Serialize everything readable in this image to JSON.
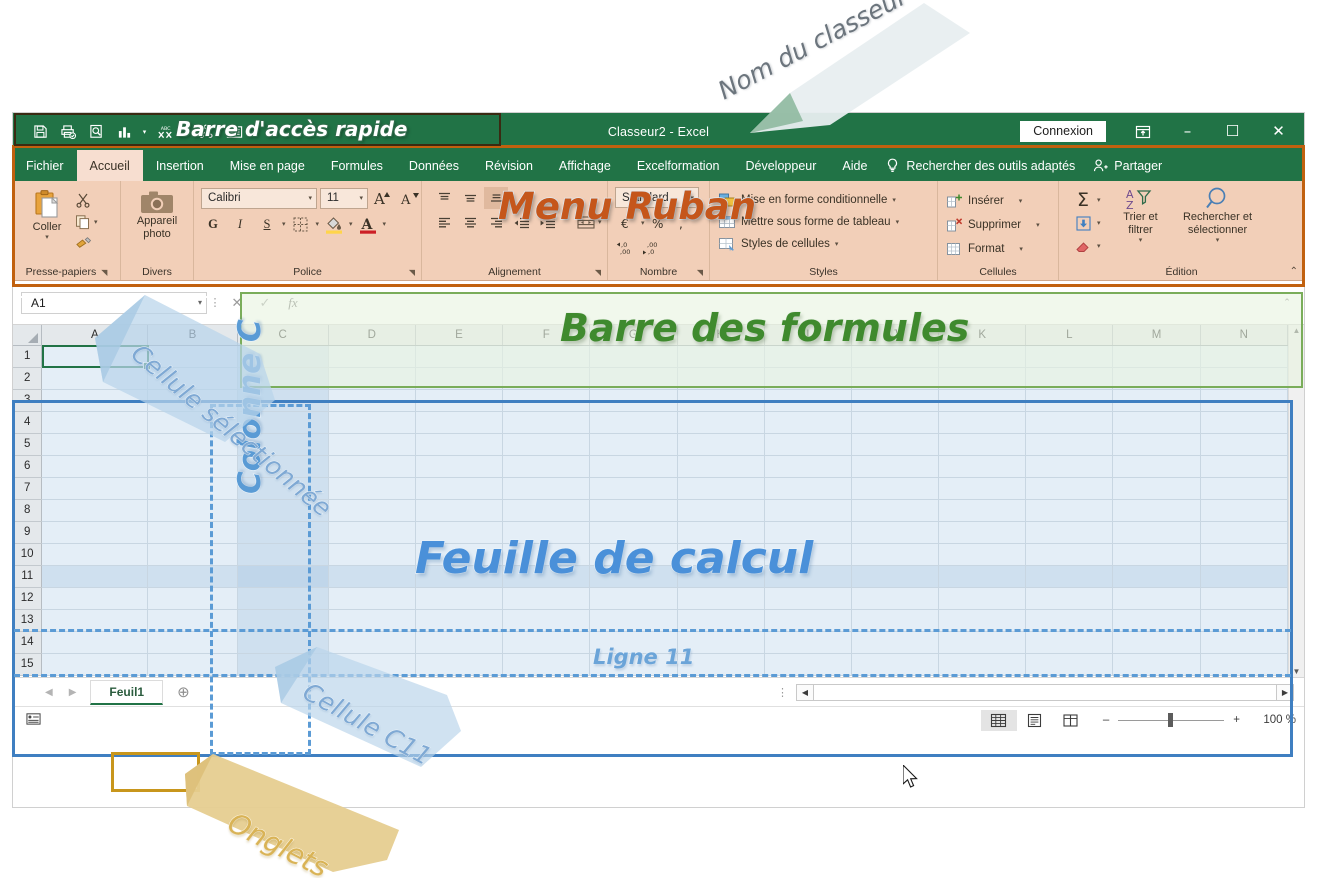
{
  "window": {
    "title": "Classeur2  -  Excel",
    "connexion_label": "Connexion"
  },
  "quick_access": {
    "icons": [
      "save-icon",
      "print-preview-send-icon",
      "print-preview-icon",
      "chart-icon",
      "spelling-icon",
      "sort-icon",
      "form-icon",
      "customize-caret-icon"
    ]
  },
  "window_controls": {
    "ribbon_display": "ribbon-display-options-icon",
    "minimize": "–",
    "restore": "☐",
    "close": "✕"
  },
  "tabs": [
    {
      "label": "Fichier",
      "active": false
    },
    {
      "label": "Accueil",
      "active": true
    },
    {
      "label": "Insertion",
      "active": false
    },
    {
      "label": "Mise en page",
      "active": false
    },
    {
      "label": "Formules",
      "active": false
    },
    {
      "label": "Données",
      "active": false
    },
    {
      "label": "Révision",
      "active": false
    },
    {
      "label": "Affichage",
      "active": false
    },
    {
      "label": "Excelformation",
      "active": false
    },
    {
      "label": "Développeur",
      "active": false
    },
    {
      "label": "Aide",
      "active": false
    }
  ],
  "tellme": {
    "label": "Rechercher des outils adaptés"
  },
  "share": {
    "label": "Partager"
  },
  "ribbon": {
    "clipboard": {
      "group_label": "Presse-papiers",
      "paste_label": "Coller",
      "cut_label": "Couper",
      "copy_label": "Copier",
      "format_painter_label": "Reproduire la mise en forme"
    },
    "divers": {
      "group_label": "Divers",
      "camera_label": "Appareil photo"
    },
    "font": {
      "group_label": "Police",
      "font_name": "Calibri",
      "font_size": "11",
      "grow_label": "A",
      "shrink_label": "A",
      "bold_label": "G",
      "italic_label": "I",
      "underline_label": "S"
    },
    "alignment": {
      "group_label": "Alignement"
    },
    "number": {
      "group_label": "Nombre",
      "format": "Standard"
    },
    "styles": {
      "group_label": "Styles",
      "items": [
        "Mise en forme conditionnelle",
        "Mettre sous forme de tableau",
        "Styles de cellules"
      ]
    },
    "cells": {
      "group_label": "Cellules",
      "items": [
        "Insérer",
        "Supprimer",
        "Format"
      ]
    },
    "editing": {
      "group_label": "Édition",
      "sum_label": "Σ",
      "sort_filter_label": "Trier et filtrer",
      "find_select_label": "Rechercher et sélectionner"
    }
  },
  "formula_bar": {
    "name_box_value": "A1",
    "cancel_icon": "✕",
    "confirm_icon": "✓",
    "fx_icon": "fx",
    "formula_value": ""
  },
  "grid": {
    "columns": [
      "A",
      "B",
      "C",
      "D",
      "E",
      "F",
      "G",
      "H",
      "I",
      "J",
      "K",
      "L",
      "M",
      "N"
    ],
    "rows": [
      "1",
      "2",
      "3",
      "4",
      "5",
      "6",
      "7",
      "8",
      "9",
      "10",
      "11",
      "12",
      "13",
      "14",
      "15"
    ],
    "selected_cell": "A1",
    "highlight_column": "C",
    "highlight_row": "11"
  },
  "sheet_tabs": {
    "prev_icon": "◀",
    "next_icon": "▶",
    "tabs": [
      "Feuil1"
    ],
    "add_label": "+"
  },
  "status_bar": {
    "macro_icon": "record-macro-icon",
    "views": [
      "normal-view-icon",
      "page-layout-view-icon",
      "page-break-view-icon"
    ],
    "zoom_out": "–",
    "zoom_in": "+",
    "zoom_level": "100 %"
  },
  "annotations": {
    "quick_access_bar": "Barre d'accès rapide",
    "workbook_name": "Nom du classeur",
    "ribbon_menu": "Menu Ruban",
    "formula_bar": "Barre des formules",
    "selected_cell": "Cellule sélectionnée",
    "worksheet": "Feuille de calcul",
    "column_c": "Colonne C",
    "row_11": "Ligne 11",
    "cell_c11": "Cellule C11",
    "sheet_tabs": "Onglets"
  },
  "colors": {
    "excel_green": "#217346",
    "ribbon_tint": "#f2cfb8",
    "ribbon_outline": "#c1610f",
    "grid_outline": "#3f7fc1",
    "highlight_blue": "#5b9bd5",
    "tab_outline": "#c8961c",
    "formula_outline": "#7aad5a",
    "annotation_orange": "#c5561b",
    "annotation_green": "#3f8a2e",
    "annotation_blue": "#4a90d9",
    "annotation_gold": "#d9b356"
  }
}
